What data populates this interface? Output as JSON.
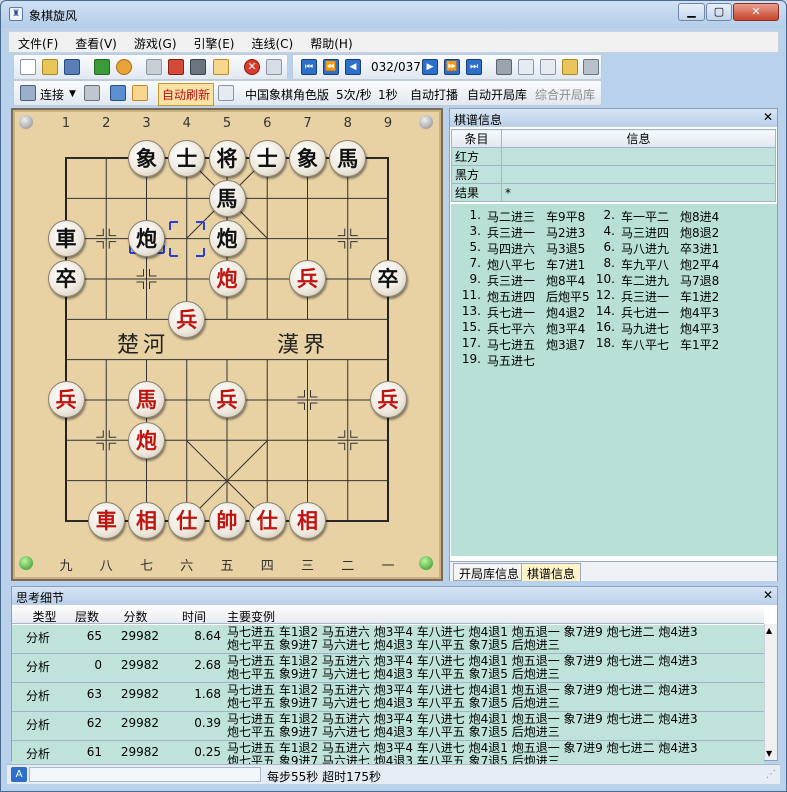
{
  "window": {
    "title": "象棋旋风",
    "app_icon": "app-icon",
    "minimize": "▁",
    "maximize": "▢",
    "close": "✕"
  },
  "menu": [
    "文件(F)",
    "查看(V)",
    "游戏(G)",
    "引擎(E)",
    "连线(C)",
    "帮助(H)"
  ],
  "toolbar1": {
    "position": "032/037"
  },
  "toolbar2": {
    "connect": "连接",
    "auto_refresh": "自动刷新",
    "engine": "中国象棋角色版",
    "speed": "5次/秒",
    "interval": "1秒",
    "auto_play": "自动打播",
    "auto_open_book": "自动开局库",
    "combo_open_book": "综合开局库"
  },
  "board": {
    "cols_top": [
      "1",
      "2",
      "3",
      "4",
      "5",
      "6",
      "7",
      "8",
      "9"
    ],
    "cols_bottom": [
      "九",
      "八",
      "七",
      "六",
      "五",
      "四",
      "三",
      "二",
      "一"
    ],
    "river_left": "楚河",
    "river_right": "漢界",
    "pieces": [
      {
        "ch": "象",
        "side": "b",
        "col": 2,
        "row": 0
      },
      {
        "ch": "士",
        "side": "b",
        "col": 3,
        "row": 0
      },
      {
        "ch": "将",
        "side": "b",
        "col": 4,
        "row": 0
      },
      {
        "ch": "士",
        "side": "b",
        "col": 5,
        "row": 0
      },
      {
        "ch": "象",
        "side": "b",
        "col": 6,
        "row": 0
      },
      {
        "ch": "馬",
        "side": "b",
        "col": 7,
        "row": 0
      },
      {
        "ch": "馬",
        "side": "b",
        "col": 4,
        "row": 1
      },
      {
        "ch": "車",
        "side": "b",
        "col": 0,
        "row": 2
      },
      {
        "ch": "炮",
        "side": "b",
        "col": 2,
        "row": 2
      },
      {
        "ch": "炮",
        "side": "b",
        "col": 4,
        "row": 2
      },
      {
        "ch": "卒",
        "side": "b",
        "col": 0,
        "row": 3
      },
      {
        "ch": "卒",
        "side": "b",
        "col": 8,
        "row": 3
      },
      {
        "ch": "炮",
        "side": "r",
        "col": 4,
        "row": 3
      },
      {
        "ch": "兵",
        "side": "r",
        "col": 6,
        "row": 3
      },
      {
        "ch": "兵",
        "side": "r",
        "col": 3,
        "row": 4
      },
      {
        "ch": "兵",
        "side": "r",
        "col": 0,
        "row": 6
      },
      {
        "ch": "馬",
        "side": "r",
        "col": 2,
        "row": 6
      },
      {
        "ch": "兵",
        "side": "r",
        "col": 4,
        "row": 6
      },
      {
        "ch": "兵",
        "side": "r",
        "col": 8,
        "row": 6
      },
      {
        "ch": "炮",
        "side": "r",
        "col": 2,
        "row": 7
      },
      {
        "ch": "車",
        "side": "r",
        "col": 1,
        "row": 9
      },
      {
        "ch": "相",
        "side": "r",
        "col": 2,
        "row": 9
      },
      {
        "ch": "仕",
        "side": "r",
        "col": 3,
        "row": 9
      },
      {
        "ch": "帥",
        "side": "r",
        "col": 4,
        "row": 9
      },
      {
        "ch": "仕",
        "side": "r",
        "col": 5,
        "row": 9
      },
      {
        "ch": "相",
        "side": "r",
        "col": 6,
        "row": 9
      }
    ]
  },
  "record_panel": {
    "title": "棋谱信息",
    "col_item": "条目",
    "col_info": "信息",
    "rows": [
      {
        "k": "红方",
        "v": ""
      },
      {
        "k": "黑方",
        "v": ""
      },
      {
        "k": "结果",
        "v": "*"
      }
    ],
    "moves": [
      {
        "n": "1.",
        "r": "马二进三",
        "b": "车9平8"
      },
      {
        "n": "2.",
        "r": "车一平二",
        "b": "炮8进4"
      },
      {
        "n": "3.",
        "r": "兵三进一",
        "b": "马2进3"
      },
      {
        "n": "4.",
        "r": "马三进四",
        "b": "炮8退2"
      },
      {
        "n": "5.",
        "r": "马四进六",
        "b": "马3退5"
      },
      {
        "n": "6.",
        "r": "马八进九",
        "b": "卒3进1"
      },
      {
        "n": "7.",
        "r": "炮八平七",
        "b": "车7进1"
      },
      {
        "n": "8.",
        "r": "车九平八",
        "b": "炮2平4"
      },
      {
        "n": "9.",
        "r": "兵三进一",
        "b": "炮8平4"
      },
      {
        "n": "10.",
        "r": "车二进九",
        "b": "马7退8"
      },
      {
        "n": "11.",
        "r": "炮五进四",
        "b": "后炮平5"
      },
      {
        "n": "12.",
        "r": "兵三进一",
        "b": "车1进2"
      },
      {
        "n": "13.",
        "r": "兵七进一",
        "b": "炮4退2"
      },
      {
        "n": "14.",
        "r": "兵七进一",
        "b": "炮4平3"
      },
      {
        "n": "15.",
        "r": "兵七平六",
        "b": "炮3平4"
      },
      {
        "n": "16.",
        "r": "马九进七",
        "b": "炮4平3"
      },
      {
        "n": "17.",
        "r": "马七进五",
        "b": "炮3退7"
      },
      {
        "n": "18.",
        "r": "车八平七",
        "b": "车1平2"
      },
      {
        "n": "19.",
        "r": "马五进七",
        "b": ""
      }
    ],
    "tab_open_book": "开局库信息",
    "tab_record": "棋谱信息"
  },
  "analysis": {
    "title": "思考细节",
    "headers": [
      "类型",
      "层数",
      "分数",
      "时间",
      "主要变例"
    ],
    "rows": [
      {
        "type": "分析",
        "depth": "65",
        "score": "29982",
        "time": "8.64",
        "l1": "马七进五 车1退2 马五进六 炮3平4 车八进七 炮4退1 炮五退一 象7进9 炮七进二 炮4进3",
        "l2": "炮七平五 象9进7 马六进七 炮4退3 车八平五 象7退5 后炮进三"
      },
      {
        "type": "分析",
        "depth": "0",
        "score": "29982",
        "time": "2.68",
        "l1": "马七进五 车1退2 马五进六 炮3平4 车八进七 炮4退1 炮五退一 象7进9 炮七进二 炮4进3",
        "l2": "炮七平五 象9进7 马六进七 炮4退3 车八平五 象7退5 后炮进三"
      },
      {
        "type": "分析",
        "depth": "63",
        "score": "29982",
        "time": "1.68",
        "l1": "马七进五 车1退2 马五进六 炮3平4 车八进七 炮4退1 炮五退一 象7进9 炮七进二 炮4进3",
        "l2": "炮七平五 象9进7 马六进七 炮4退3 车八平五 象7退5 后炮进三"
      },
      {
        "type": "分析",
        "depth": "62",
        "score": "29982",
        "time": "0.39",
        "l1": "马七进五 车1退2 马五进六 炮3平4 车八进七 炮4退1 炮五退一 象7进9 炮七进二 炮4进3",
        "l2": "炮七平五 象9进7 马六进七 炮4退3 车八平五 象7退5 后炮进三"
      },
      {
        "type": "分析",
        "depth": "61",
        "score": "29982",
        "time": "0.25",
        "l1": "马七进五 车1退2 马五进六 炮3平4 车八进七 炮4退1 炮五退一 象7进9 炮七进二 炮4进3",
        "l2": "炮七平五 象9进7 马六进七 炮4退3 车八平五 象7退5 后炮进三"
      }
    ]
  },
  "status": {
    "indicator": "A",
    "time_control": "每步55秒 超时175秒"
  }
}
